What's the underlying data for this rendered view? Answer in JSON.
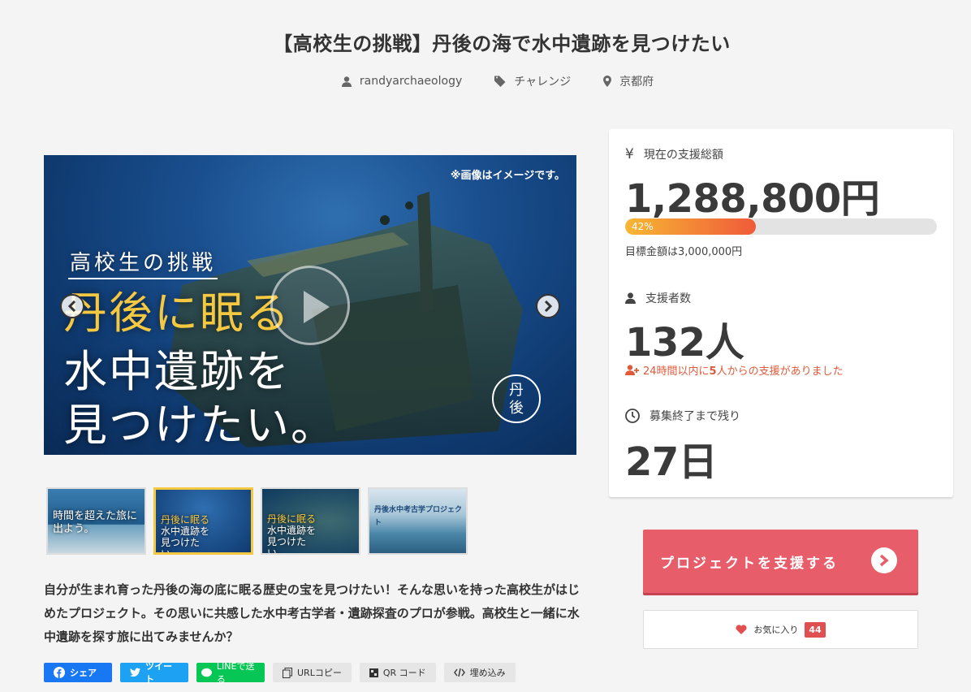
{
  "project": {
    "title": "【高校生の挑戦】丹後の海で水中遺跡を見つけたい",
    "author": "randyarchaeology",
    "category": "チャレンジ",
    "location": "京都府"
  },
  "hero": {
    "note": "※画像はイメージです。",
    "line1": "高校生の挑戦",
    "line2": "丹後に眠る",
    "line3": "水中遺跡を",
    "line4": "見つけたい。",
    "seal": "丹後"
  },
  "thumbnails": [
    {
      "caption": "時間を超えた旅に出よう。"
    },
    {
      "caption_top": "丹後に眠る",
      "caption_bottom": "水中遺跡を見つけたい。"
    },
    {
      "caption_top": "丹後に眠る",
      "caption_bottom": "水中遺跡を見つけたい。"
    },
    {
      "caption": "丹後水中考古学プロジェクト"
    }
  ],
  "description": "自分が生まれ育った丹後の海の底に眠る歴史の宝を見つけたい！そんな思いを持った高校生がはじめたプロジェクト。その思いに共感した水中考古学者・遺跡探査のプロが参戦。高校生と一緒に水中遺跡を探す旅に出てみませんか？",
  "share": {
    "facebook": "シェア",
    "twitter": "ツイート",
    "line": "LINEで送る",
    "url_copy": "URLコピー",
    "qr": "QR コード",
    "embed": "埋め込み"
  },
  "stats": {
    "total_label": "現在の支援総額",
    "total": "1,288,800円",
    "progress_percent": 42,
    "progress_label": "42%",
    "goal": "目標金額は3,000,000円",
    "backers_label": "支援者数",
    "backers": "132人",
    "recent_prefix": "24時間以内に",
    "recent_count": "5",
    "recent_suffix": "人からの支援がありました",
    "remaining_label": "募集終了まで残り",
    "remaining": "27日"
  },
  "actions": {
    "support": "プロジェクトを支援する",
    "favorite": "お気に入り",
    "favorite_count": "44"
  },
  "colors": {
    "support_button": "#e85d6a",
    "progress_start": "#f7b733",
    "progress_end": "#f05a3a",
    "accent_red": "#e05a3a"
  }
}
